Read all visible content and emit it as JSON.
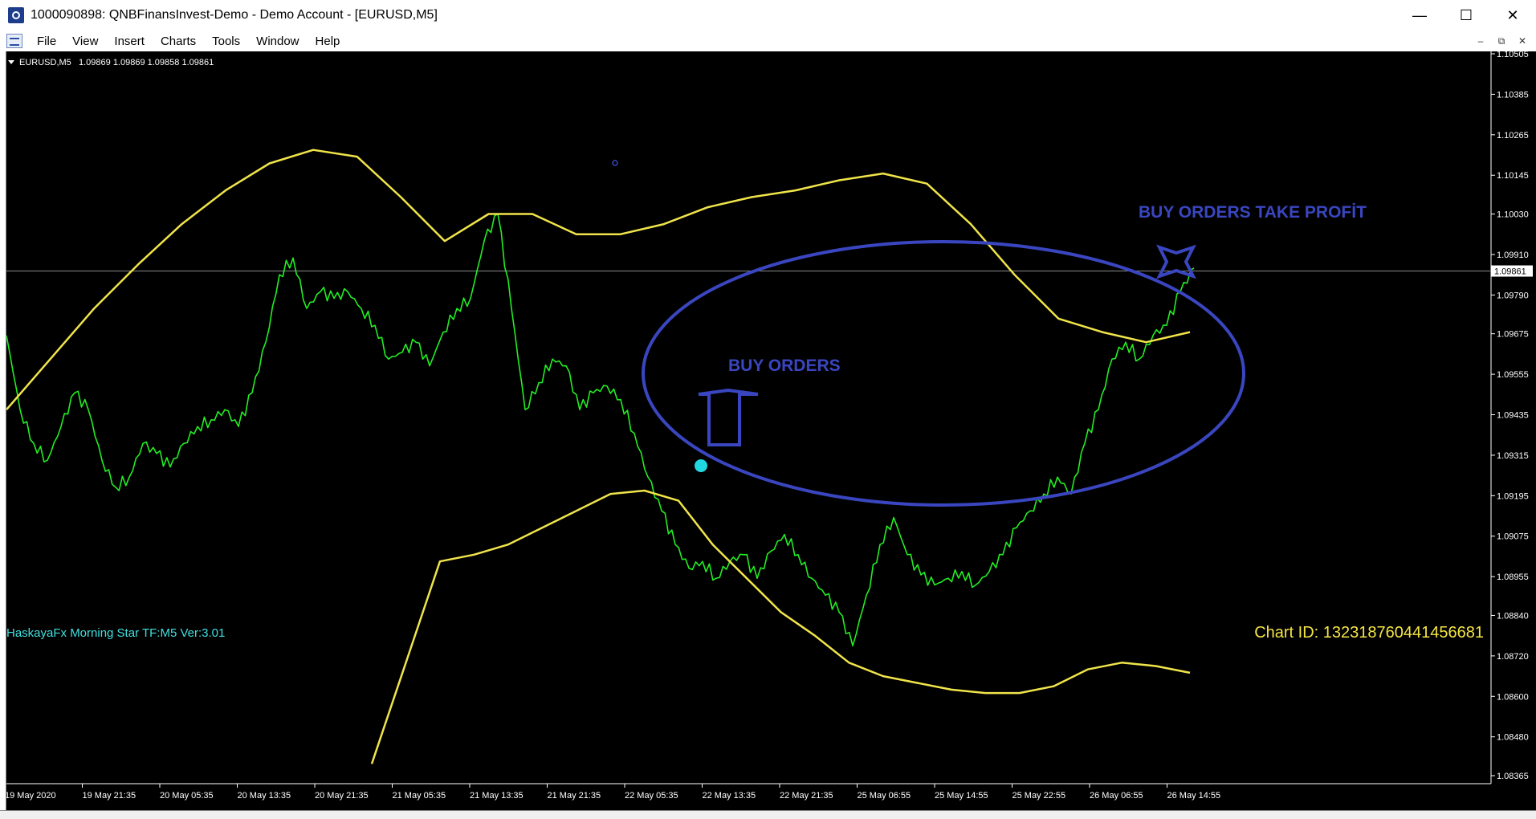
{
  "window": {
    "title": "1000090898: QNBFinansInvest-Demo - Demo Account - [EURUSD,M5]",
    "controls": [
      "—",
      "☐",
      "✕"
    ]
  },
  "menu": {
    "items": [
      "File",
      "View",
      "Insert",
      "Charts",
      "Tools",
      "Window",
      "Help"
    ],
    "mdi_controls": [
      "–",
      "⧉",
      "✕"
    ]
  },
  "chart": {
    "symbol_label": "EURUSD,M5",
    "ohlc_label": "1.09869 1.09869 1.09858 1.09861",
    "current_price": "1.09861",
    "indicator_label": "HaskayaFx Morning Star TF:M5 Ver:3.01",
    "chart_id": "Chart ID: 132318760441456681",
    "annotation_buy": "BUY ORDERS",
    "annotation_take_profit": "BUY ORDERS TAKE PROFİT",
    "colors": {
      "background": "#000000",
      "price_line": "#22ee22",
      "envelope": "#f0e44a",
      "annotation": "#3a46c0",
      "indicator_text": "#40e0e0",
      "chart_id_text": "#f5e642",
      "axis_text": "#ffffff"
    }
  },
  "chart_data": {
    "type": "line",
    "price_axis_ticks": [
      "1.10505",
      "1.10385",
      "1.10265",
      "1.10145",
      "1.10030",
      "1.09910",
      "1.09790",
      "1.09675",
      "1.09555",
      "1.09435",
      "1.09315",
      "1.09195",
      "1.09075",
      "1.08955",
      "1.08840",
      "1.08720",
      "1.08600",
      "1.08480",
      "1.08365"
    ],
    "time_axis_ticks": [
      "19 May 2020",
      "19 May 21:35",
      "20 May 05:35",
      "20 May 13:35",
      "20 May 21:35",
      "21 May 05:35",
      "21 May 13:35",
      "21 May 21:35",
      "22 May 05:35",
      "22 May 13:35",
      "22 May 21:35",
      "25 May 06:55",
      "25 May 14:55",
      "25 May 22:55",
      "26 May 06:55",
      "26 May 14:55"
    ],
    "ylim": [
      1.08365,
      1.10505
    ],
    "series": [
      {
        "values": [
          1.0967,
          1.0945,
          1.0935,
          1.093,
          1.094,
          1.095,
          1.0945,
          1.093,
          1.0922,
          1.0925,
          1.0935,
          1.0932,
          1.0928,
          1.0935,
          1.094,
          1.0942,
          1.0945,
          1.094,
          1.095,
          1.0965,
          1.0985,
          1.099,
          1.0975,
          1.098,
          1.0978,
          1.098,
          1.0975,
          1.097,
          1.096,
          1.0962,
          1.0965,
          1.0958,
          1.0968,
          1.0975,
          1.0978,
          1.0995,
          1.1003,
          1.0975,
          1.0945,
          1.0953,
          1.096,
          1.0958,
          1.0945,
          1.095,
          1.0952,
          1.0948,
          1.0938,
          1.0925,
          1.0915,
          1.0905,
          1.0898,
          1.09,
          1.0895,
          1.09,
          1.0902,
          1.0895,
          1.0903,
          1.0908,
          1.0902,
          1.0895,
          1.089,
          1.0885,
          1.0875,
          1.089,
          1.0905,
          1.0913,
          1.0902,
          1.0896,
          1.0893,
          1.0895,
          1.0897,
          1.0893,
          1.0897,
          1.0902,
          1.091,
          1.0915,
          1.092,
          1.0925,
          1.092,
          1.0935,
          1.0945,
          1.096,
          1.0965,
          1.096,
          1.0967,
          1.097,
          1.098,
          1.0987
        ]
      },
      {
        "values": [
          1.0945,
          1.096,
          1.0975,
          1.0988,
          1.1,
          1.101,
          1.1018,
          1.1022,
          1.102,
          1.1008,
          1.0995,
          1.1003,
          1.1003,
          1.0997,
          1.0997,
          1.1,
          1.1005,
          1.1008,
          1.101,
          1.1013,
          1.1015,
          1.1012,
          1.1,
          1.0985,
          1.0972,
          1.0968,
          1.0965,
          1.0968
        ]
      },
      {
        "values": [
          1.084,
          1.087,
          1.09,
          1.0902,
          1.0905,
          1.091,
          1.0915,
          1.092,
          1.0921,
          1.0918,
          1.0905,
          1.0895,
          1.0885,
          1.0878,
          1.087,
          1.0866,
          1.0864,
          1.0862,
          1.0861,
          1.0861,
          1.0863,
          1.0868,
          1.087,
          1.0869,
          1.0867
        ]
      }
    ]
  }
}
